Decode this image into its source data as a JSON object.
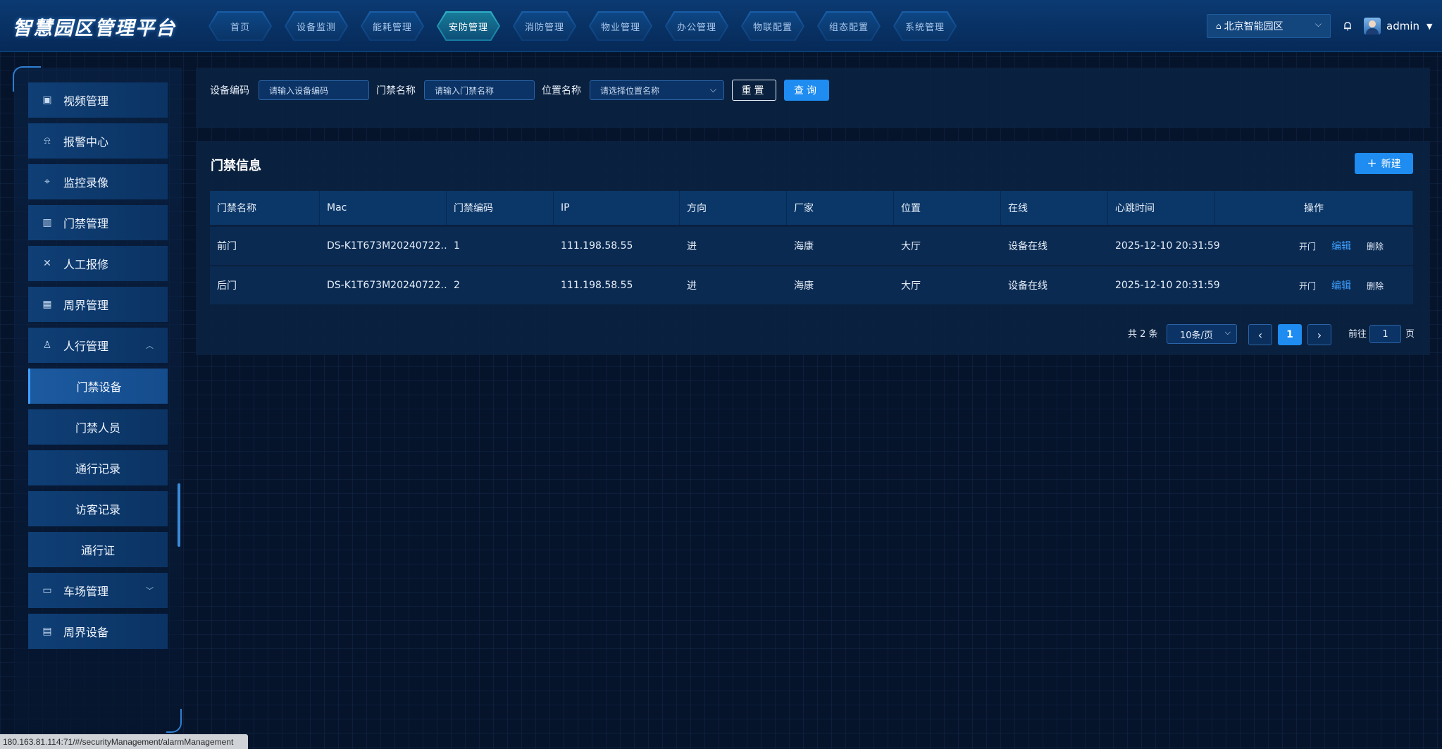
{
  "header": {
    "logo": "智慧园区管理平台",
    "nav_tabs": [
      {
        "label": "首页"
      },
      {
        "label": "设备监测"
      },
      {
        "label": "能耗管理"
      },
      {
        "label": "安防管理",
        "active": true
      },
      {
        "label": "消防管理"
      },
      {
        "label": "物业管理"
      },
      {
        "label": "办公管理"
      },
      {
        "label": "物联配置"
      },
      {
        "label": "组态配置"
      },
      {
        "label": "系统管理"
      }
    ],
    "park_selector": "北京智能园区",
    "username": "admin"
  },
  "sidebar": {
    "items": [
      {
        "label": "视频管理",
        "icon": "video-icon"
      },
      {
        "label": "报警中心",
        "icon": "alarm-icon"
      },
      {
        "label": "监控录像",
        "icon": "camera-icon"
      },
      {
        "label": "门禁管理",
        "icon": "map-icon"
      },
      {
        "label": "人工报修",
        "icon": "tools-icon"
      },
      {
        "label": "周界管理",
        "icon": "building-icon"
      },
      {
        "label": "人行管理",
        "icon": "person-icon",
        "expanded": true
      },
      {
        "label": "车场管理",
        "icon": "parking-icon"
      },
      {
        "label": "周界设备",
        "icon": "device-icon"
      }
    ],
    "sub_items": [
      {
        "label": "门禁设备",
        "active": true
      },
      {
        "label": "门禁人员"
      },
      {
        "label": "通行记录"
      },
      {
        "label": "访客记录"
      },
      {
        "label": "通行证"
      }
    ]
  },
  "search": {
    "device_code_label": "设备编码",
    "device_code_placeholder": "请输入设备编码",
    "door_name_label": "门禁名称",
    "door_name_placeholder": "请输入门禁名称",
    "location_label": "位置名称",
    "location_placeholder": "请选择位置名称",
    "reset_label": "重置",
    "query_label": "查询"
  },
  "list": {
    "title": "门禁信息",
    "new_label": "新建",
    "columns": [
      "门禁名称",
      "Mac",
      "门禁编码",
      "IP",
      "方向",
      "厂家",
      "位置",
      "在线",
      "心跳时间",
      "操作"
    ],
    "rows": [
      {
        "name": "前门",
        "mac": "DS-K1T673M20240722…",
        "code": "1",
        "ip": "111.198.58.55",
        "direction": "进",
        "vendor": "海康",
        "location": "大厅",
        "online": "设备在线",
        "heartbeat": "2025-12-10 20:31:59"
      },
      {
        "name": "后门",
        "mac": "DS-K1T673M20240722…",
        "code": "2",
        "ip": "111.198.58.55",
        "direction": "进",
        "vendor": "海康",
        "location": "大厅",
        "online": "设备在线",
        "heartbeat": "2025-12-10 20:31:59"
      }
    ],
    "actions": {
      "open": "开门",
      "edit": "编辑",
      "delete": "删除"
    }
  },
  "pagination": {
    "total": "共 2 条",
    "page_size": "10条/页",
    "current_page": "1",
    "goto_prefix": "前往",
    "goto_value": "1",
    "goto_suffix": "页"
  },
  "status_url": "180.163.81.114:71/#/securityManagement/alarmManagement",
  "colors": {
    "accent": "#1e8cf0",
    "link": "#3ea0ff",
    "panel": "#0a2242"
  }
}
